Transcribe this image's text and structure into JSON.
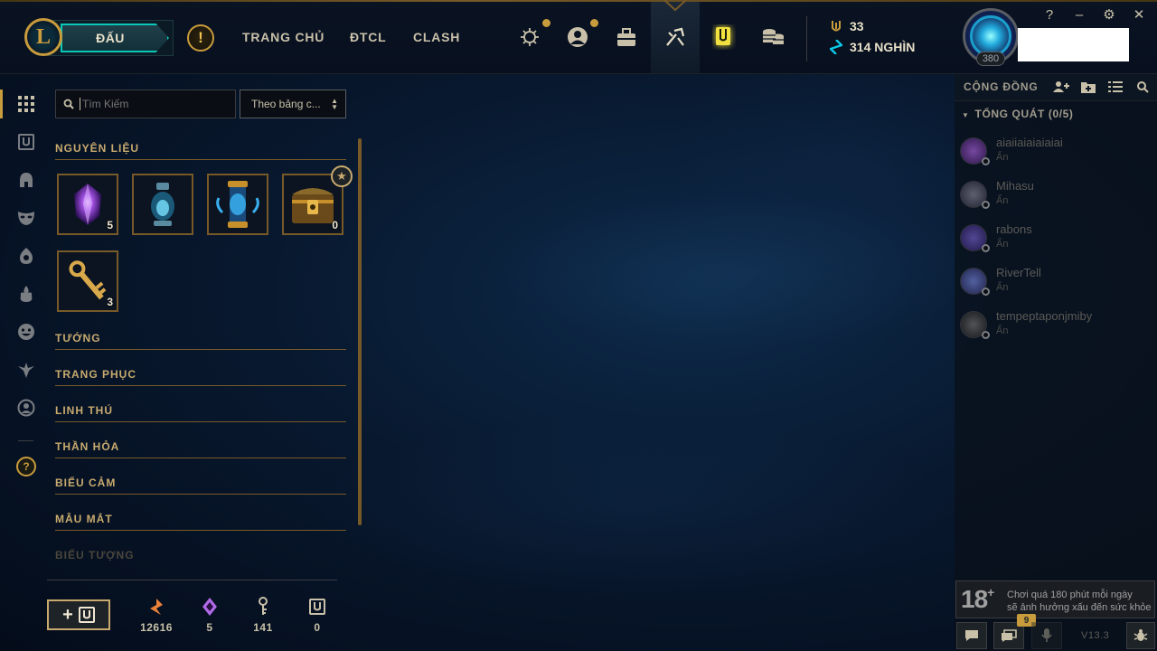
{
  "header": {
    "logo_letter": "L",
    "play_label": "ĐẤU",
    "alert_glyph": "!",
    "nav": [
      {
        "label": "TRANG CHỦ"
      },
      {
        "label": "ĐTCL"
      },
      {
        "label": "CLASH"
      }
    ],
    "icons": [
      "profile-emblem-icon",
      "profile-icon",
      "collection-icon",
      "loot-icon",
      "crafting-icon",
      "store-icon"
    ],
    "currency": {
      "blue_essence": "33",
      "riot_points": "314 NGHÌN"
    },
    "level": "380",
    "window_controls": {
      "help": "?",
      "minimize": "–",
      "settings": "⚙",
      "close": "✕"
    }
  },
  "sidebar": {
    "items": [
      "all-items-icon",
      "chest-icon",
      "champion-helmet-icon",
      "skin-mask-icon",
      "ward-icon",
      "summoner-icon",
      "emote-icon",
      "eternals-icon",
      "icon-profile-icon"
    ],
    "help_glyph": "?"
  },
  "loot": {
    "search_placeholder": "Tìm Kiếm",
    "sort_label": "Theo bảng c...",
    "sections": [
      {
        "title": "NGUYÊN LIỆU"
      },
      {
        "title": "TƯỚNG"
      },
      {
        "title": "TRANG PHỤC"
      },
      {
        "title": "LINH THÚ"
      },
      {
        "title": "THẦN HỎA"
      },
      {
        "title": "BIỂU CẢM"
      },
      {
        "title": "MẪU MẮT"
      },
      {
        "title": "BIỂU TƯỢNG"
      }
    ],
    "materials": [
      {
        "name": "mythic-essence-icon",
        "count": "5"
      },
      {
        "name": "mastery-token-lantern-icon",
        "count": ""
      },
      {
        "name": "mastery-token-capsule-icon",
        "count": ""
      },
      {
        "name": "hextech-chest-icon",
        "count": "0"
      },
      {
        "name": "hextech-key-icon",
        "count": "3"
      }
    ],
    "footer_stats": [
      {
        "name": "orange-essence-icon",
        "value": "12616",
        "color": "#e8823a"
      },
      {
        "name": "mythic-essence-icon",
        "value": "5",
        "color": "#b06ae8"
      },
      {
        "name": "key-fragment-icon",
        "value": "141",
        "color": "#c8c0a8"
      },
      {
        "name": "chest-count-icon",
        "value": "0",
        "color": "#c8c0a8"
      }
    ],
    "craft_label": "+"
  },
  "social": {
    "title": "CỘNG ĐỒNG",
    "group": "TỔNG QUÁT (0/5)",
    "friends": [
      {
        "name": "aiaiiaiaiaiaiai",
        "status": "Ẩn",
        "color": "#6a3a8a"
      },
      {
        "name": "Mihasu",
        "status": "Ẩn",
        "color": "#4a4a5a"
      },
      {
        "name": "rabons",
        "status": "Ẩn",
        "color": "#3a3a7a"
      },
      {
        "name": "RiverTell",
        "status": "Ẩn",
        "color": "#3a4a7a"
      },
      {
        "name": "tempeptaponjmiby",
        "status": "Ẩn",
        "color": "#3a3a3a"
      }
    ],
    "age_rating": "18",
    "age_plus": "+",
    "age_warning_line1": "Chơi quá 180 phút mỗi ngày",
    "age_warning_line2": "sẽ ảnh hưởng xấu đến sức khỏe",
    "chat_badge": "9",
    "version": "V13.3"
  }
}
